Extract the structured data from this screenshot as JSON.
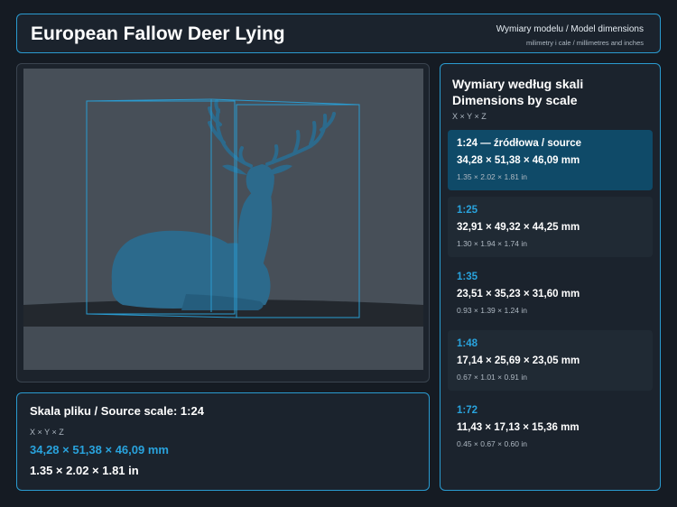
{
  "header": {
    "title": "European Fallow Deer Lying",
    "subtitle": "Wymiary modelu / Model dimensions",
    "units_note": "milimetry i cale / millimetres and inches"
  },
  "viewer": {
    "model_icon": "deer-model-render",
    "accent": "#2a9bd0"
  },
  "source": {
    "title": "Skala pliku / Source scale: 1:24",
    "axes": "X × Y × Z",
    "mm": "34,28 × 51,38 × 46,09 mm",
    "inches": "1.35 × 2.02 × 1.81 in"
  },
  "scales": {
    "title": "Wymiary według skali Dimensions by scale",
    "axes": "X × Y × Z",
    "items": [
      {
        "label": "1:24  —  źródłowa / source",
        "mm": "34,28 × 51,38 × 46,09 mm",
        "inches": "1.35 × 2.02 × 1.81 in",
        "active": true
      },
      {
        "label": "1:25",
        "mm": "32,91 × 49,32 × 44,25 mm",
        "inches": "1.30 × 1.94 × 1.74 in"
      },
      {
        "label": "1:35",
        "mm": "23,51 × 35,23 × 31,60 mm",
        "inches": "0.93 × 1.39 × 1.24 in"
      },
      {
        "label": "1:48",
        "mm": "17,14 × 25,69 × 23,05 mm",
        "inches": "0.67 × 1.01 × 0.91 in"
      },
      {
        "label": "1:72",
        "mm": "11,43 × 17,13 × 15,36 mm",
        "inches": "0.45 × 0.67 × 0.60 in"
      }
    ]
  },
  "colors": {
    "accent": "#29a3dd",
    "active_card": "#0f4a68",
    "background": "#151b23"
  }
}
